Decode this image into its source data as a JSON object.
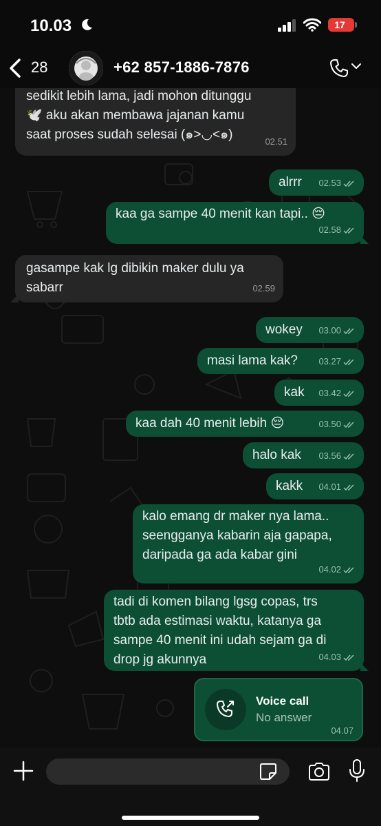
{
  "status_bar": {
    "time": "10.03",
    "battery_level": "17"
  },
  "header": {
    "back_count": "28",
    "contact": "+62 857-1886-7876"
  },
  "messages": [
    {
      "dir": "in",
      "text": "sedikit lebih lama,  jadi mohon ditunggu\n🕊️ aku akan membawa jajanan kamu\nsaat proses sudah selesai (๑>◡<๑)",
      "time": "02.51"
    },
    {
      "dir": "out",
      "text": "alrrr",
      "time": "02.53"
    },
    {
      "dir": "out",
      "text": "kaa ga sampe 40 menit kan tapi.. 😔",
      "time": "02.58"
    },
    {
      "dir": "in",
      "text": "gasampe kak lg dibikin maker dulu ya\nsabarr",
      "time": "02.59"
    },
    {
      "dir": "out",
      "text": "wokey",
      "time": "03.00"
    },
    {
      "dir": "out",
      "text": "masi lama kak?",
      "time": "03.27"
    },
    {
      "dir": "out",
      "text": "kak",
      "time": "03.42"
    },
    {
      "dir": "out",
      "text": "kaa dah 40 menit lebih 😔",
      "time": "03.50"
    },
    {
      "dir": "out",
      "text": "halo kak",
      "time": "03.56"
    },
    {
      "dir": "out",
      "text": "kakk",
      "time": "04.01"
    },
    {
      "dir": "out",
      "text": "kalo emang dr maker nya lama..\nseengganya kabarin aja gapapa,\ndaripada ga ada kabar gini",
      "time": "04.02"
    },
    {
      "dir": "out",
      "text": "tadi di komen bilang lgsg copas, trs\ntbtb ada estimasi waktu, katanya ga\nsampe 40 menit ini udah sejam ga di\ndrop jg akunnya",
      "time": "04.03"
    }
  ],
  "call": {
    "title": "Voice call",
    "status": "No answer",
    "time": "04.07"
  },
  "colors": {
    "outgoing": "#0c4f34",
    "incoming": "#262626",
    "background": "#0e0e0e"
  }
}
